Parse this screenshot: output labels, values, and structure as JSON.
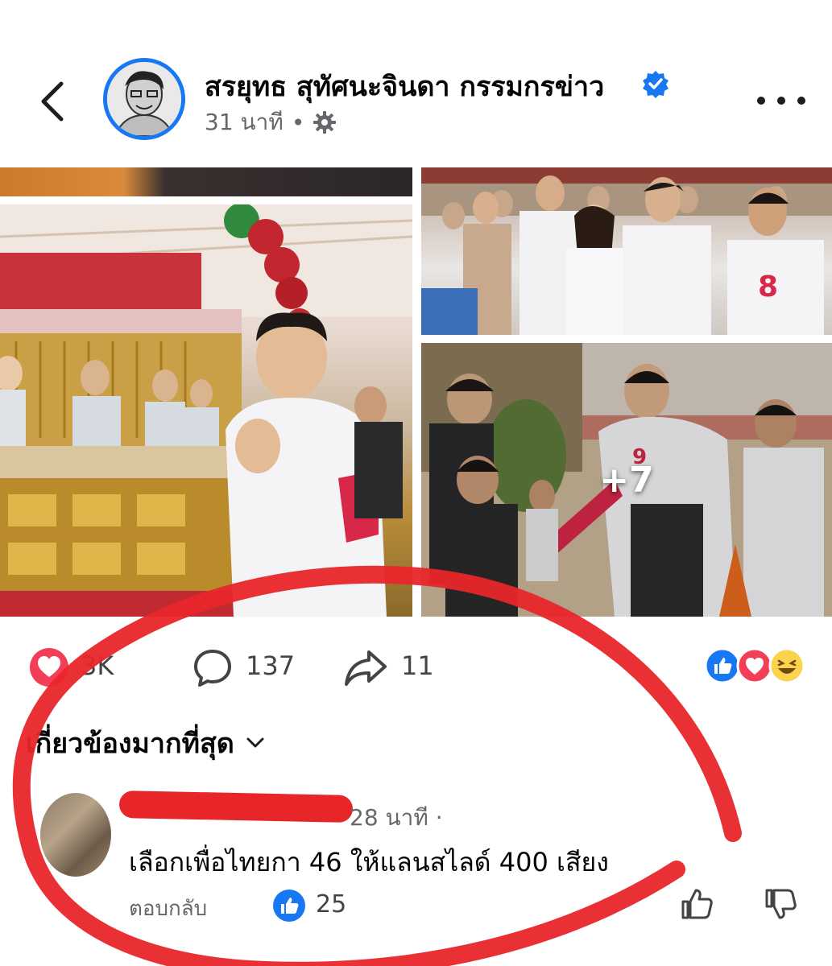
{
  "header": {
    "author_name": "สรยุทธ สุทัศนะจินดา กรรมกรข่าว",
    "time": "31 นาที",
    "separator": "•",
    "icons": {
      "back": "chevron-left-icon",
      "verified": "verified-badge-icon",
      "audience": "gear-icon",
      "more": "more-dots-icon"
    }
  },
  "photos": {
    "more_count": "+7"
  },
  "reactions": {
    "count": "3K",
    "comments": "137",
    "shares": "11",
    "stack": [
      "like",
      "love",
      "haha"
    ]
  },
  "sort": {
    "label": "เกี่ยวข้องมากที่สุด"
  },
  "comment": {
    "time": "28 นาที ·",
    "text": "เลือกเพื่อไทยกา 46 ให้แลนสไลด์ 400 เสียง",
    "reply_label": "ตอบกลับ",
    "likes": "25"
  },
  "colors": {
    "accent": "#1877f2",
    "love": "#f33e58",
    "annotation": "#e8262a",
    "secondary_text": "#65676b"
  }
}
